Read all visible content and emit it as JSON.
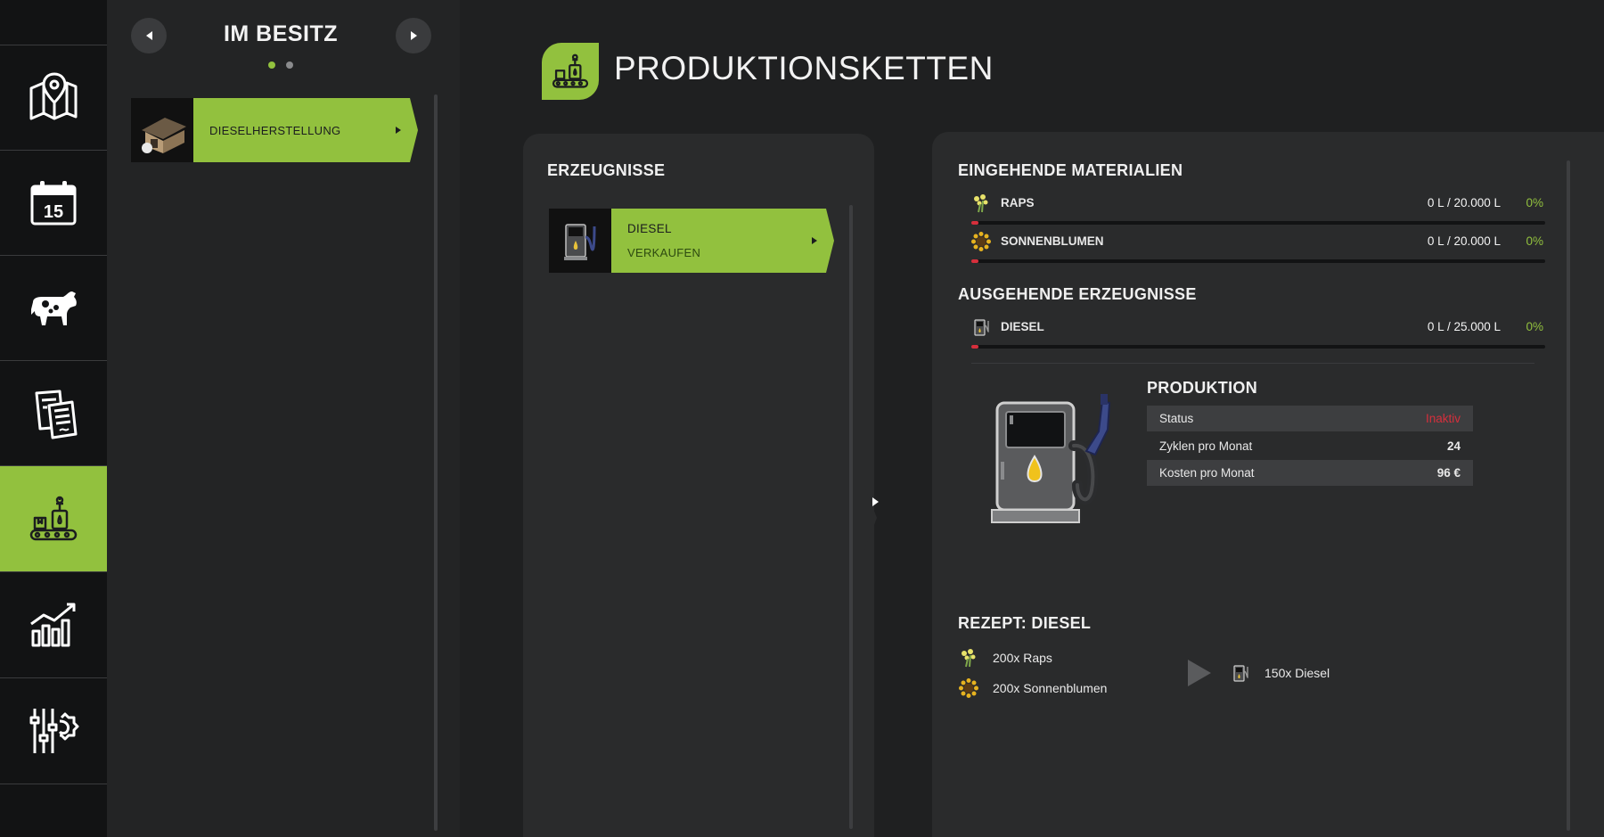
{
  "nav": {
    "items": [
      {
        "name": "map-icon"
      },
      {
        "name": "calendar-icon",
        "day": "15"
      },
      {
        "name": "animals-icon"
      },
      {
        "name": "contracts-icon"
      },
      {
        "name": "production-icon"
      },
      {
        "name": "statistics-icon"
      },
      {
        "name": "settings-icon"
      }
    ],
    "active_index": 4
  },
  "owned": {
    "title": "IM BESITZ",
    "page_index": 0,
    "page_count": 2,
    "items": [
      {
        "label": "DIESELHERSTELLUNG",
        "icon": "shed-icon",
        "selected": true
      }
    ]
  },
  "header": {
    "title": "PRODUKTIONSKETTEN",
    "icon": "production-chain-icon"
  },
  "products": {
    "title": "ERZEUGNISSE",
    "items": [
      {
        "label": "DIESEL",
        "sublabel": "VERKAUFEN",
        "icon": "fuel-pump-icon",
        "selected": true
      }
    ]
  },
  "incoming": {
    "title": "EINGEHENDE MATERIALIEN",
    "items": [
      {
        "name": "RAPS",
        "icon": "canola-icon",
        "amount": "0 L / 20.000 L",
        "percent": "0%",
        "fill": 0
      },
      {
        "name": "SONNENBLUMEN",
        "icon": "sunflower-icon",
        "amount": "0 L / 20.000 L",
        "percent": "0%",
        "fill": 0
      }
    ]
  },
  "outgoing": {
    "title": "AUSGEHENDE ERZEUGNISSE",
    "items": [
      {
        "name": "DIESEL",
        "icon": "fuel-icon",
        "amount": "0 L / 25.000 L",
        "percent": "0%",
        "fill": 0
      }
    ]
  },
  "production": {
    "title": "PRODUKTION",
    "rows": [
      {
        "label": "Status",
        "value": "Inaktiv"
      },
      {
        "label": "Zyklen pro Monat",
        "value": "24"
      },
      {
        "label": "Kosten pro Monat",
        "value": "96 €"
      }
    ]
  },
  "recipe": {
    "title": "REZEPT: DIESEL",
    "inputs": [
      {
        "label": "200x Raps",
        "icon": "canola-icon"
      },
      {
        "label": "200x Sonnenblumen",
        "icon": "sunflower-icon"
      }
    ],
    "outputs": [
      {
        "label": "150x Diesel",
        "icon": "fuel-icon"
      }
    ]
  },
  "colors": {
    "accent": "#92c13e",
    "inactive": "#d62f3c",
    "bg": "#1f2021"
  }
}
